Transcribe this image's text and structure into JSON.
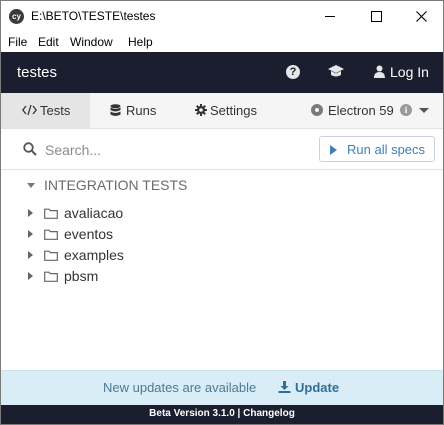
{
  "window": {
    "title": "E:\\BETO\\TESTE\\testes",
    "app_icon_text": "cy"
  },
  "menu": {
    "items": [
      "File",
      "Edit",
      "Window",
      "Help"
    ]
  },
  "header": {
    "project_name": "testes",
    "login_label": "Log In"
  },
  "nav": {
    "tabs": [
      {
        "label": "Tests",
        "icon": "code-icon",
        "active": true
      },
      {
        "label": "Runs",
        "icon": "database-icon",
        "active": false
      },
      {
        "label": "Settings",
        "icon": "gear-icon",
        "active": false
      }
    ],
    "browser": {
      "label": "Electron 59",
      "icon": "chrome-icon"
    }
  },
  "search": {
    "placeholder": "Search...",
    "value": "",
    "run_all_label": "Run all specs"
  },
  "specs": {
    "section_label": "INTEGRATION TESTS",
    "folders": [
      "avaliacao",
      "eventos",
      "examples",
      "pbsm"
    ]
  },
  "update": {
    "text": "New updates are available",
    "link_label": "Update"
  },
  "footer": {
    "version_text": "Beta Version 3.1.0",
    "separator": " | ",
    "changelog_label": "Changelog"
  },
  "colors": {
    "header_bg": "#1b1e2e",
    "accent": "#3f7fb8",
    "banner_bg": "#d9edf7"
  }
}
